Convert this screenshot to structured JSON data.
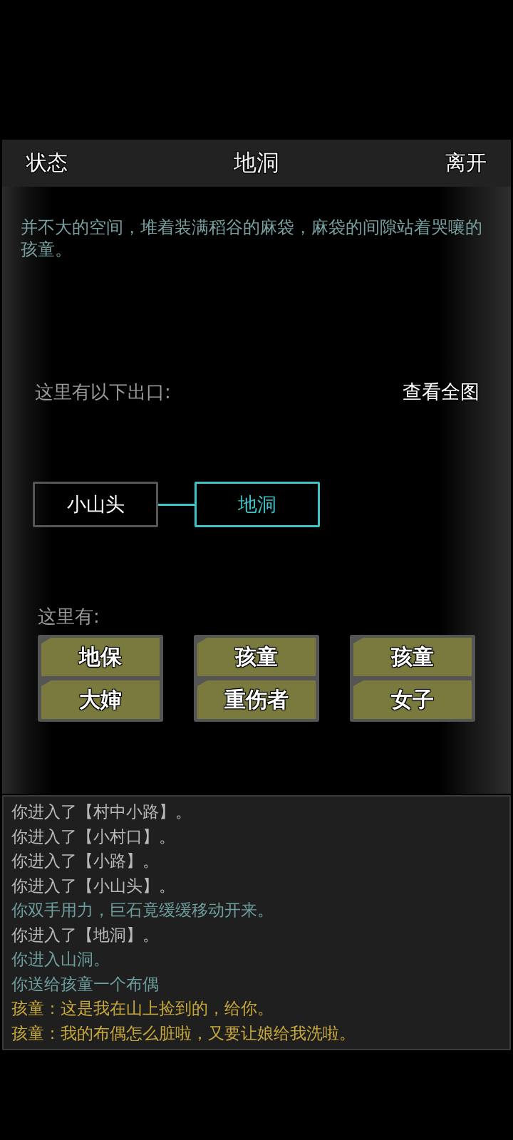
{
  "header": {
    "left": "状态",
    "title": "地洞",
    "right": "离开"
  },
  "description": "并不大的空间，堆着装满稻谷的麻袋，麻袋的间隙站着哭嚷的孩童。",
  "exits_label": "这里有以下出口:",
  "map_button": "查看全图",
  "exits": [
    {
      "label": "小山头",
      "selected": false
    },
    {
      "label": "地洞",
      "selected": true
    }
  ],
  "people_label": "这里有:",
  "people": [
    "地保",
    "孩童",
    "孩童",
    "大婶",
    "重伤者",
    "女子"
  ],
  "log": [
    {
      "kind": "plain",
      "text": "你进入了【村中小路】。"
    },
    {
      "kind": "plain",
      "text": "你进入了【小村口】。"
    },
    {
      "kind": "plain",
      "text": "你进入了【小路】。"
    },
    {
      "kind": "plain",
      "text": "你进入了【小山头】。"
    },
    {
      "kind": "action",
      "text": "你双手用力，巨石竟缓缓移动开来。"
    },
    {
      "kind": "plain",
      "text": "你进入了【地洞】。"
    },
    {
      "kind": "action",
      "text": "你进入山洞。"
    },
    {
      "kind": "action",
      "text": "你送给孩童一个布偶"
    },
    {
      "kind": "speech",
      "text": "孩童：这是我在山上捡到的，给你。"
    },
    {
      "kind": "speech",
      "text": "孩童：我的布偶怎么脏啦，又要让娘给我洗啦。"
    }
  ]
}
